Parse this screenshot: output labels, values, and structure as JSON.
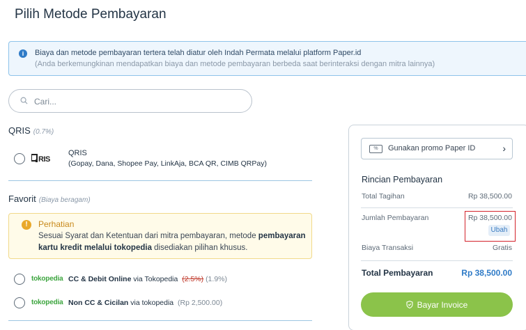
{
  "page": {
    "title": "Pilih Metode Pembayaran"
  },
  "info": {
    "icon": "info-icon",
    "line1": "Biaya dan metode pembayaran tertera telah diatur oleh Indah Permata melalui platform Paper.id",
    "line2": "(Anda berkemungkinan mendapatkan biaya dan metode pembayaran berbeda saat berinteraksi dengan mitra lainnya)"
  },
  "search": {
    "placeholder": "Cari..."
  },
  "qris_section": {
    "title": "QRIS",
    "note": "(0.7%)",
    "option": {
      "logo": "QRIS",
      "name": "QRIS",
      "desc": "(Gopay, Dana, Shopee Pay, LinkAja, BCA QR, CIMB QRPay)"
    }
  },
  "favorit_section": {
    "title": "Favorit",
    "note": "(Biaya beragam)",
    "warning": {
      "title": "Perhatian",
      "text_pre": "Sesuai Syarat dan Ketentuan dari mitra pembayaran, metode ",
      "text_bold": "pembayaran kartu kredit melalui tokopedia",
      "text_post": " disediakan pilihan khusus."
    },
    "options": [
      {
        "logo": "tokopedia",
        "name": "CC & Debit Online",
        "via": " via Tokopedia",
        "old_fee": "(2.5%)",
        "fee": "(1.9%)"
      },
      {
        "logo": "tokopedia",
        "name": "Non CC & Cicilan",
        "via": " via tokopedia",
        "fee": "(Rp 2,500.00)"
      }
    ]
  },
  "summary": {
    "promo_label": "Gunakan promo Paper ID",
    "promo_icon_text": "%",
    "title": "Rincian Pembayaran",
    "rows": {
      "total_tagihan": {
        "label": "Total Tagihan",
        "value": "Rp 38,500.00"
      },
      "jumlah_pembayaran": {
        "label": "Jumlah Pembayaran",
        "value": "Rp 38,500.00",
        "action": "Ubah"
      },
      "biaya_transaksi": {
        "label": "Biaya Transaksi",
        "value": "Gratis"
      }
    },
    "total_label": "Total Pembayaran",
    "total_value": "Rp 38,500.00",
    "pay_button": "Bayar Invoice"
  },
  "colors": {
    "accent_blue": "#2f7bc7",
    "pay_green": "#8bc34a",
    "warning_orange": "#e9a82a",
    "highlight_red": "#d3222a",
    "tokopedia_green": "#3da53f"
  }
}
